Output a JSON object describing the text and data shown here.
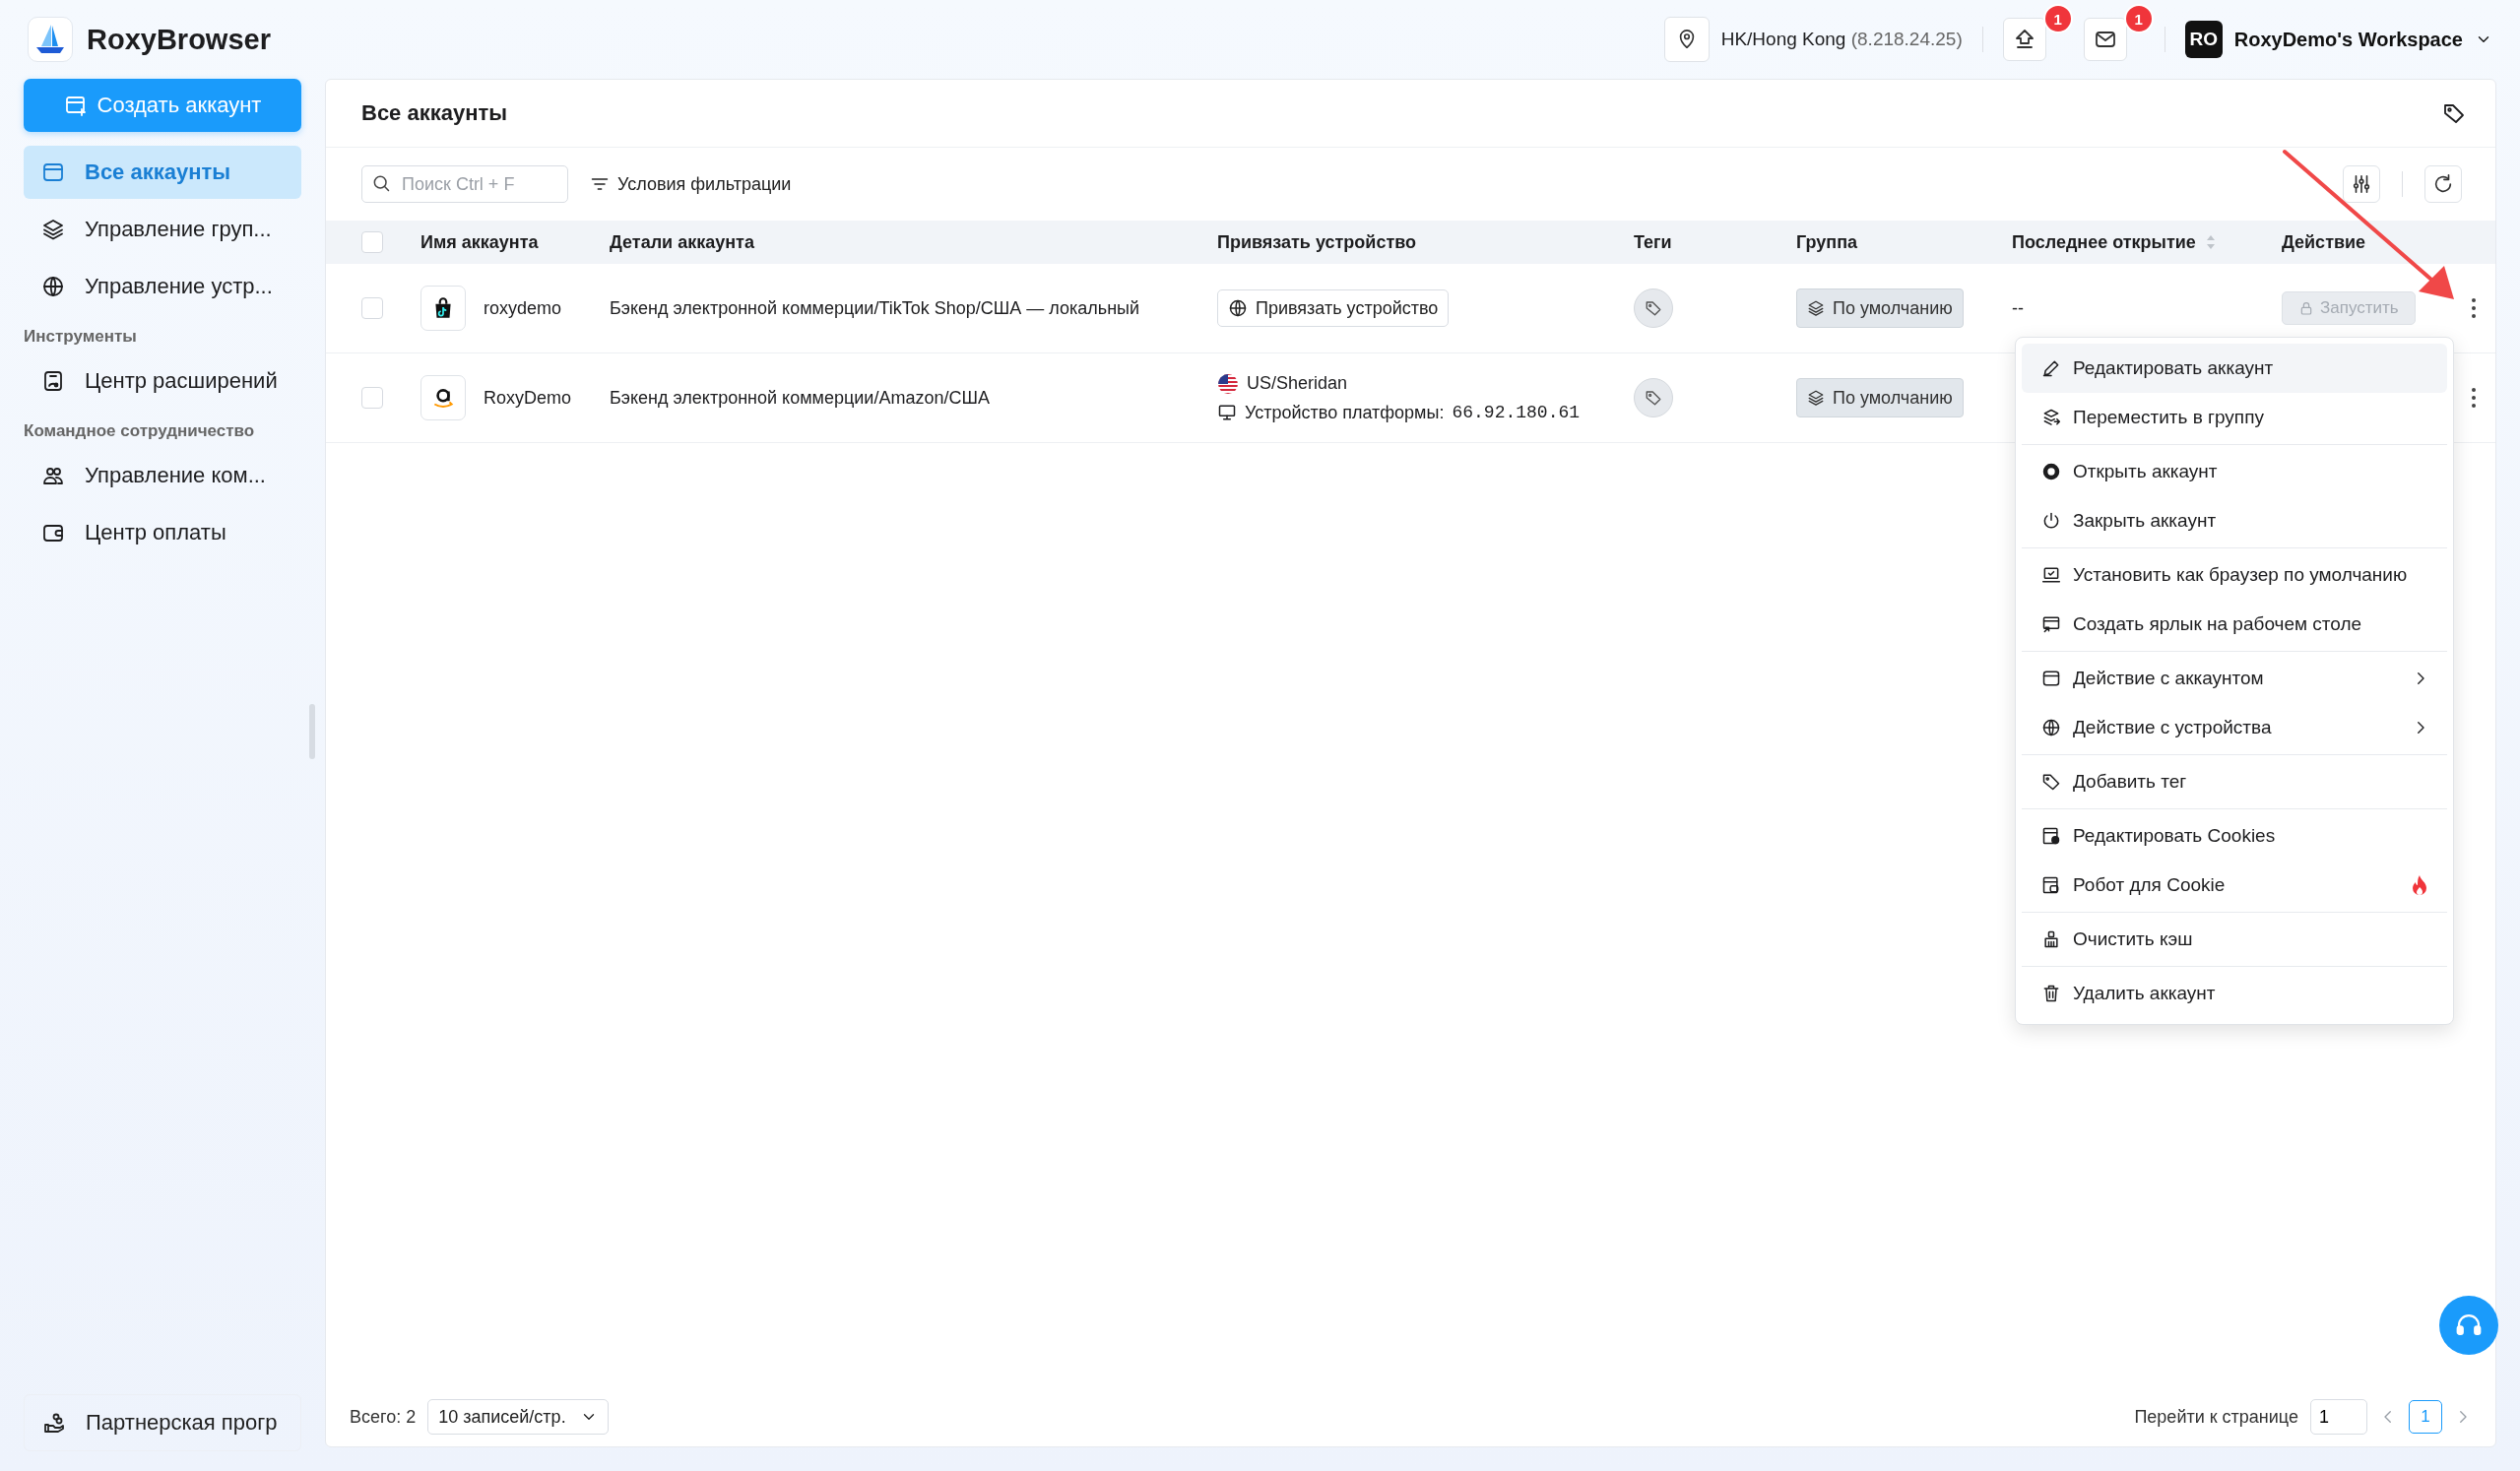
{
  "app": {
    "name": "RoxyBrowser"
  },
  "header": {
    "location": "HK/Hong Kong",
    "ip": "(8.218.24.25)",
    "upload_badge": "1",
    "mail_badge": "1",
    "workspace_avatar": "RO",
    "workspace_name": "RoxyDemo's Workspace"
  },
  "sidebar": {
    "create_button": "Создать аккаунт",
    "sections": [
      {
        "items": [
          {
            "label": "Все аккаунты",
            "selected": true
          },
          {
            "label": "Управление груп...",
            "selected": false
          },
          {
            "label": "Управление устр...",
            "selected": false
          }
        ]
      },
      {
        "title": "Инструменты",
        "items": [
          {
            "label": "Центр расширений",
            "selected": false
          }
        ]
      },
      {
        "title": "Командное сотрудничество",
        "items": [
          {
            "label": "Управление ком...",
            "selected": false
          },
          {
            "label": "Центр оплаты",
            "selected": false
          }
        ]
      }
    ],
    "partner": "Партнерская прогр"
  },
  "panel": {
    "title": "Все аккаунты",
    "search": {
      "placeholder": "Поиск Ctrl + F"
    },
    "filter_button": "Условия фильтрации"
  },
  "table": {
    "select_all": {
      "checked": false
    },
    "columns": [
      {
        "label": "Имя аккаунта",
        "sortable": false
      },
      {
        "label": "Детали аккаунта",
        "sortable": false
      },
      {
        "label": "Привязать устройство",
        "sortable": false
      },
      {
        "label": "Теги",
        "sortable": false
      },
      {
        "label": "Группа",
        "sortable": false
      },
      {
        "label": "Последнее открытие",
        "sortable": true
      },
      {
        "label": "Действие",
        "sortable": false
      }
    ],
    "rows": [
      {
        "checked": false,
        "name": "roxydemo",
        "details": "Бэкенд электронной коммерции/TikTok Shop/США — локальный",
        "device": {
          "kind": "bind",
          "label": "Привязать устройство"
        },
        "group": "По умолчанию",
        "last_opened": "--",
        "launch": {
          "label": "Запустить",
          "disabled": true
        }
      },
      {
        "checked": false,
        "name": "RoxyDemo",
        "details": "Бэкенд электронной коммерции/Amazon/США",
        "device": {
          "kind": "bound",
          "location": "US/Sheridan",
          "platform_label": "Устройство платформы:",
          "ip": "66.92.180.61"
        },
        "group": "По умолчанию"
      }
    ]
  },
  "context_menu": {
    "groups": [
      [
        {
          "label": "Редактировать аккаунт",
          "kind": "action",
          "selected": true
        },
        {
          "label": "Переместить в группу",
          "kind": "action",
          "selected": false
        }
      ],
      [
        {
          "label": "Открыть аккаунт",
          "kind": "action",
          "selected": false
        },
        {
          "label": "Закрыть аккаунт",
          "kind": "action",
          "selected": false
        }
      ],
      [
        {
          "label": "Установить как браузер по умолчанию",
          "kind": "action",
          "selected": false
        },
        {
          "label": "Создать ярлык на рабочем столе",
          "kind": "action",
          "selected": false
        }
      ],
      [
        {
          "label": "Действие с аккаунтом",
          "kind": "submenu",
          "selected": false
        },
        {
          "label": "Действие с устройства",
          "kind": "submenu",
          "selected": false
        }
      ],
      [
        {
          "label": "Добавить тег",
          "kind": "action",
          "selected": false
        }
      ],
      [
        {
          "label": "Редактировать Cookies",
          "kind": "action",
          "selected": false
        },
        {
          "label": "Робот для Cookie",
          "kind": "hot",
          "selected": false
        }
      ],
      [
        {
          "label": "Очистить кэш",
          "kind": "action",
          "selected": false
        }
      ],
      [
        {
          "label": "Удалить аккаунт",
          "kind": "action",
          "selected": false
        }
      ]
    ]
  },
  "footer": {
    "total": "Всего: 2",
    "page_size": "10 записей/стр.",
    "goto_label": "Перейти к странице",
    "goto_value": "1",
    "pages": [
      {
        "label": "1",
        "selected": true
      }
    ]
  }
}
